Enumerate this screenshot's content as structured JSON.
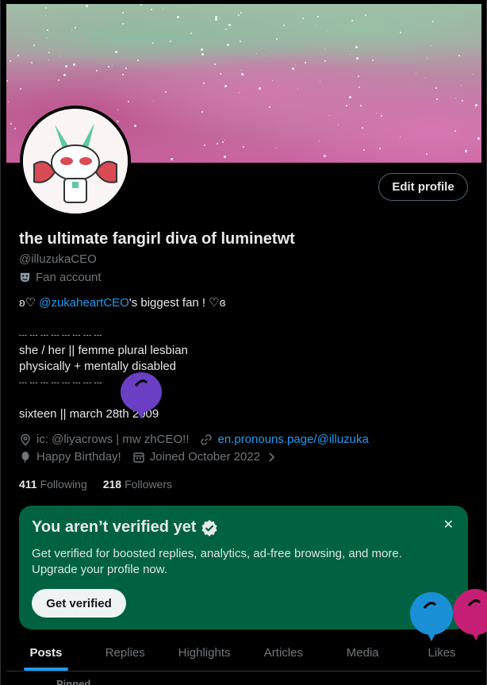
{
  "profile": {
    "name": "the ultimate fangirl diva of luminetwt",
    "handle": "@illuzukaCEO",
    "category": "Fan account",
    "edit_label": "Edit profile"
  },
  "bio": {
    "line1_prefix": "ʚ♡ ",
    "line1_mention": "@zukaheartCEO",
    "line1_suffix": "'s biggest fan ! ♡ɞ",
    "separator1": "--- --- --- --- --- --- --- ---",
    "line2": "she / her || femme plural lesbian",
    "line3": "physically + mentally disabled",
    "separator2": "--- --- --- --- --- --- --- ---",
    "line4": "sixteen ||  march 28th 2009"
  },
  "meta": {
    "location": "ic: @liyacrows | mw zhCEO!!",
    "website": "en.pronouns.page/@illuzuka",
    "birthday": "Happy Birthday!",
    "joined": "Joined October 2022"
  },
  "stats": {
    "following_count": "411",
    "following_label": "Following",
    "followers_count": "218",
    "followers_label": "Followers"
  },
  "verify": {
    "title": "You aren’t verified yet",
    "body": "Get verified for boosted replies, analytics, ad-free browsing, and more. Upgrade your profile now.",
    "button": "Get verified",
    "close": "✕"
  },
  "tabs": [
    {
      "label": "Posts"
    },
    {
      "label": "Replies"
    },
    {
      "label": "Highlights"
    },
    {
      "label": "Articles"
    },
    {
      "label": "Media"
    },
    {
      "label": "Likes"
    }
  ],
  "pinned": "Pinned",
  "colors": {
    "accent": "#1d9bf0",
    "verify_bg": "#006241",
    "balloon_purple": "#6a3fc4",
    "balloon_blue": "#1a8fd6",
    "balloon_pink": "#c41f74"
  }
}
